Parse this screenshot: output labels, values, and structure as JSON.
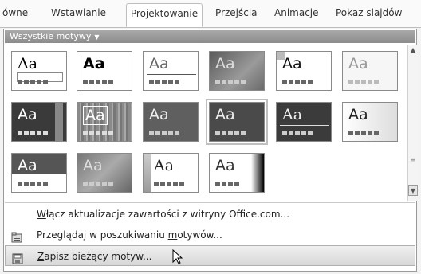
{
  "ribbon": {
    "tabs": [
      {
        "label": "ówne"
      },
      {
        "label": "Wstawianie"
      },
      {
        "label": "Projektowanie",
        "active": true
      },
      {
        "label": "Przejścia"
      },
      {
        "label": "Animacje"
      },
      {
        "label": "Pokaz slajdów"
      }
    ]
  },
  "gallery": {
    "header": "Wszystkie motywy",
    "themes": [
      {
        "sample": "Aa"
      },
      {
        "sample": "Aa"
      },
      {
        "sample": "Aa"
      },
      {
        "sample": "Aa"
      },
      {
        "sample": "Aa"
      },
      {
        "sample": "Aa"
      },
      {
        "sample": "Aa"
      },
      {
        "sample": "Aa"
      },
      {
        "sample": "Aa"
      },
      {
        "sample": "Aa"
      },
      {
        "sample": "Aa"
      },
      {
        "sample": "Aa"
      },
      {
        "sample": "Aa"
      },
      {
        "sample": "Aa"
      },
      {
        "sample": "Aa"
      },
      {
        "sample": "Aa"
      }
    ]
  },
  "menu": {
    "items": [
      {
        "pre": "",
        "u": "W",
        "post": "łącz aktualizacje zawartości z witryny Office.com..."
      },
      {
        "pre": "Przeglądaj w poszukiwaniu ",
        "u": "m",
        "post": "otywów..."
      },
      {
        "pre": "",
        "u": "Z",
        "post": "apisz bieżący motyw..."
      }
    ]
  },
  "icons": {
    "dropdown": "chevron-down-icon",
    "browse": "folder-icon",
    "save": "save-theme-icon",
    "cursor": "mouse-pointer-icon"
  }
}
